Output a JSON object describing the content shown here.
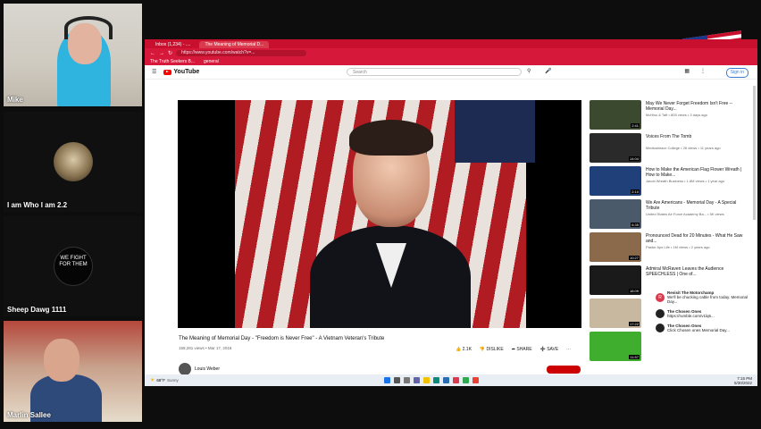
{
  "participants": [
    {
      "name": "Mike"
    },
    {
      "name": "I am Who I am 2.2"
    },
    {
      "name": "Sheep Dawg 1111",
      "avatar_text": "WE FIGHT FOR THEM"
    },
    {
      "name": "Marlin Sallee"
    }
  ],
  "browser": {
    "tabs": [
      "Inbox (1,234) - ....",
      "The Meaning of Memorial D..."
    ],
    "url": "https://www.youtube.com/watch?v=...",
    "bookmarks": [
      "The Truth Seekers B...",
      "general"
    ]
  },
  "youtube": {
    "logo": "YouTube",
    "search_placeholder": "Search",
    "signin": "Sign in",
    "video_title": "The Meaning of Memorial Day - \"Freedom is Never Free\" - A Vietnam Veteran's Tribute",
    "video_meta": "158,281 views • Mar 17, 2018",
    "actions": [
      "2.1K",
      "DISLIKE",
      "SHARE",
      "SAVE"
    ],
    "channel": "Louis Weber",
    "recommendations": [
      {
        "title": "May We Never Forget Freedom Isn't Free -- Memorial Day...",
        "sub": "McHiss & Taft • 805 views • 3 days ago",
        "duration": "2:41"
      },
      {
        "title": "Voices From The Tomb",
        "sub": "Medicalmaxx College • 26 views • 11 years ago",
        "duration": "14:04"
      },
      {
        "title": "How to Make the American Flag Flower Wreath | How to Make...",
        "sub": "Jacob Wreath Business • 1.8M views • 1 year ago",
        "duration": "2:10"
      },
      {
        "title": "We Are Americans - Memorial Day - A Special Tribute",
        "sub": "United States Air Force Academy Ba... • 5K views",
        "duration": "6:35"
      },
      {
        "title": "Pronounced Dead for 20 Minutes - What He Saw and...",
        "sub": "Pastor Ayo Life • 1M views • 2 years ago",
        "duration": "10:27"
      },
      {
        "title": "Admiral McRaven Leaves the Audience SPEECHLESS | One of...",
        "sub": "",
        "duration": "16:09"
      },
      {
        "title": "",
        "sub": "",
        "duration": "17:22"
      },
      {
        "title": "",
        "sub": "",
        "duration": "11:57"
      },
      {
        "title": "",
        "sub": "",
        "duration": ""
      }
    ]
  },
  "notifications": {
    "items": [
      {
        "title": "Revisit The Motorchamp",
        "body": "We'll be chucking cable from today. Memorial Day..."
      },
      {
        "title": "The Chosen Ones",
        "body": "https://rumble.com/v1lq6..."
      },
      {
        "title": "The Chosen Ones",
        "body": "Click Chosen ones Memorial Day..."
      }
    ]
  },
  "taskbar": {
    "weather": "68°F",
    "weather_sub": "Sunny",
    "time": "7:15 PM",
    "date": "5/30/2022"
  },
  "colors": {
    "accent": "#c8102e",
    "youtube_red": "#ff0000",
    "background": "#0d0d0d"
  }
}
